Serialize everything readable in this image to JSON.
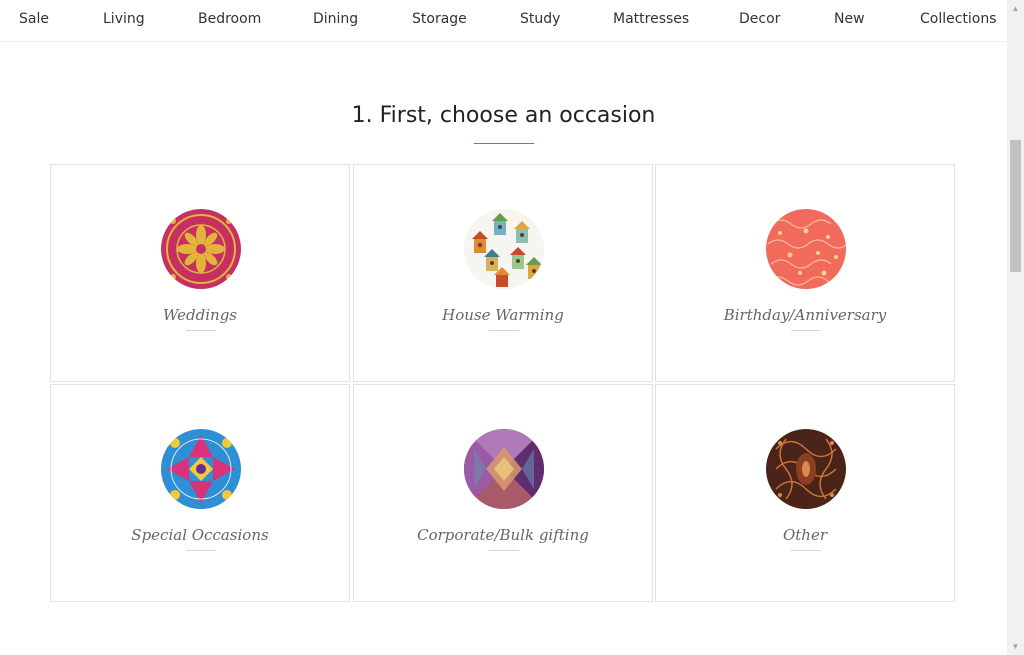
{
  "nav": {
    "items": [
      "Sale",
      "Living",
      "Bedroom",
      "Dining",
      "Storage",
      "Study",
      "Mattresses",
      "Decor",
      "New",
      "Collections"
    ]
  },
  "main": {
    "heading": "1. First, choose an occasion",
    "accent_color": "#d0573a",
    "occasions": [
      {
        "label": "Weddings",
        "icon": "mandala-pattern-icon"
      },
      {
        "label": "House Warming",
        "icon": "birdhouse-pattern-icon"
      },
      {
        "label": "Birthday/Anniversary",
        "icon": "coral-doodle-pattern-icon"
      },
      {
        "label": "Special Occasions",
        "icon": "kaleidoscope-pattern-icon"
      },
      {
        "label": "Corporate/Bulk gifting",
        "icon": "purple-prism-pattern-icon"
      },
      {
        "label": "Other",
        "icon": "brown-paisley-pattern-icon"
      }
    ]
  }
}
